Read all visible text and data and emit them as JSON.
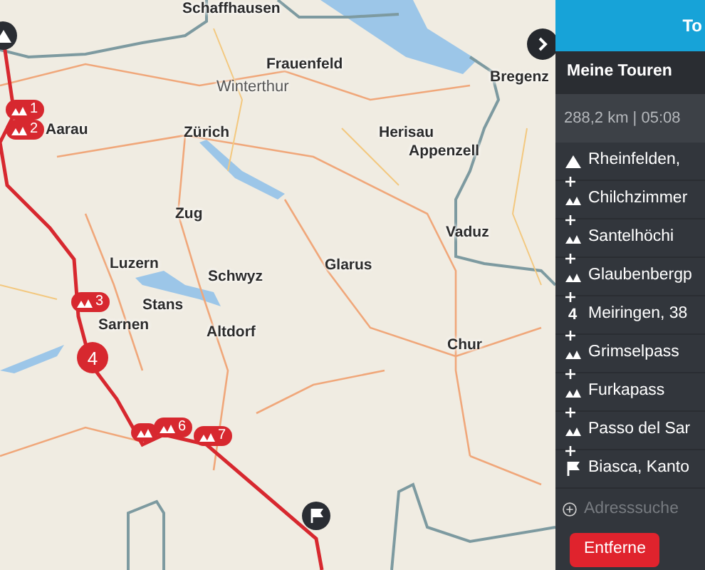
{
  "map": {
    "places": [
      "Schaffhausen",
      "Frauenfeld",
      "Winterthur",
      "Aarau",
      "Zürich",
      "Zug",
      "Luzern",
      "Schwyz",
      "Glarus",
      "Stans",
      "Sarnen",
      "Altdorf",
      "Herisau",
      "Appenzell",
      "Vaduz",
      "Chur",
      "Bregenz"
    ],
    "markers": [
      {
        "kind": "start"
      },
      {
        "kind": "pass",
        "label": "1"
      },
      {
        "kind": "pass",
        "label": "2"
      },
      {
        "kind": "pass",
        "label": "3"
      },
      {
        "kind": "stop",
        "label": "4"
      },
      {
        "kind": "pass"
      },
      {
        "kind": "pass",
        "label": "6"
      },
      {
        "kind": "pass",
        "label": "7"
      },
      {
        "kind": "finish"
      }
    ]
  },
  "panel": {
    "header": "To",
    "title": "Meine Touren",
    "summary": "288,2 km | 05:08",
    "waypoints": [
      {
        "kind": "start",
        "name": "Rheinfelden,"
      },
      {
        "kind": "pass",
        "name": "Chilchzimmer"
      },
      {
        "kind": "pass",
        "name": "Santelhöchi"
      },
      {
        "kind": "pass",
        "name": "Glaubenbergp"
      },
      {
        "kind": "stop",
        "label": "4",
        "name": "Meiringen, 38"
      },
      {
        "kind": "pass",
        "name": "Grimselpass"
      },
      {
        "kind": "pass",
        "name": "Furkapass"
      },
      {
        "kind": "pass",
        "name": "Passo del Sar"
      },
      {
        "kind": "finish",
        "name": "Biasca, Kanto"
      }
    ],
    "search": {
      "placeholder": "Adresssuche"
    },
    "remove_button": "Entferne"
  }
}
